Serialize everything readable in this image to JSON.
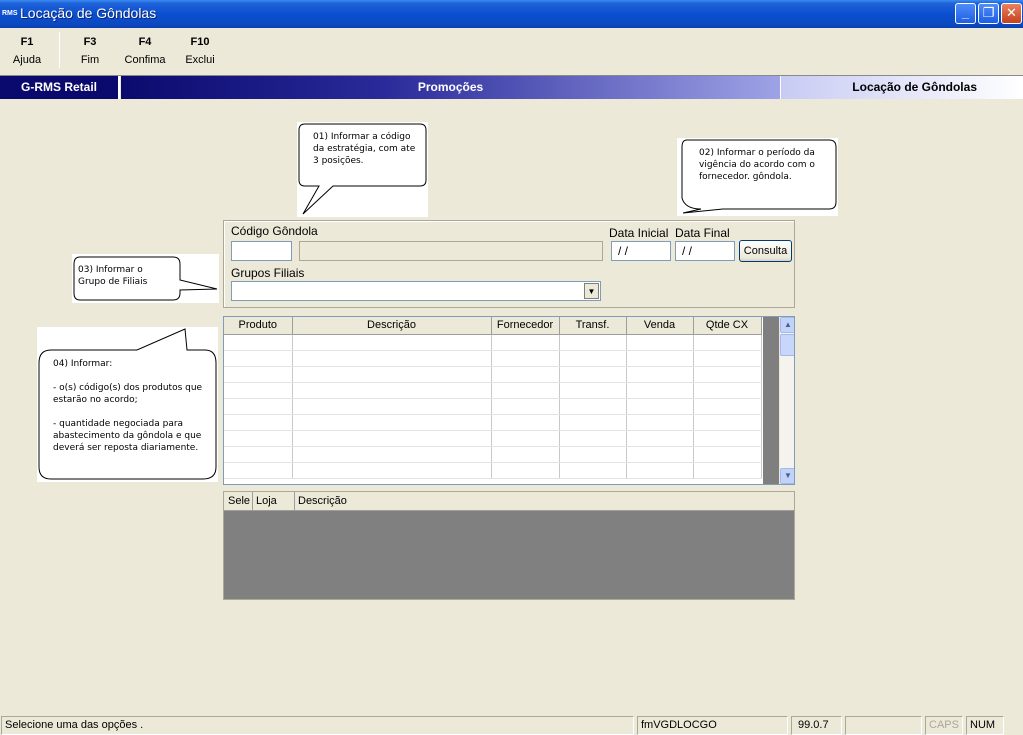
{
  "window": {
    "app_icon": "RMS",
    "title": "Locação de Gôndolas",
    "controls": {
      "minimize": "_",
      "restore": "❐",
      "close": "✕"
    }
  },
  "toolbar": {
    "items": [
      {
        "key": "F1",
        "label": "Ajuda"
      },
      {
        "key": "F3",
        "label": "Fim"
      },
      {
        "key": "F4",
        "label": "Confima"
      },
      {
        "key": "F10",
        "label": "Exclui"
      }
    ]
  },
  "banner": {
    "left": "G-RMS Retail",
    "center": "Promoções",
    "right": "Locação de Gôndolas"
  },
  "callouts": {
    "c1": [
      "01) Informar a código",
      "da estratégia, com ate",
      "3 posições."
    ],
    "c2": [
      "02) Informar o período da",
      "vigência do acordo com o",
      "fornecedor. gôndola."
    ],
    "c3": [
      "03) Informar o",
      "Grupo de Filiais"
    ],
    "c4": [
      "04) Informar:",
      "",
      "- o(s) código(s) dos produtos que",
      "estarão no acordo;",
      "",
      "- quantidade negociada para",
      "abastecimento da gôndola e que",
      "deverá ser reposta diariamente."
    ]
  },
  "form": {
    "codigo_label": "Código Gôndola",
    "codigo_value": "",
    "descricao_value": "",
    "data_inicial_label": "Data Inicial",
    "data_inicial_value": "/ /",
    "data_final_label": "Data Final",
    "data_final_value": "/ /",
    "consulta_label": "Consulta",
    "grupos_label": "Grupos Filiais",
    "grupos_value": ""
  },
  "grid": {
    "columns": [
      "Produto",
      "Descrição",
      "Fornecedor",
      "Transf.",
      "Venda",
      "Qtde CX"
    ],
    "rows": [
      [
        "",
        "",
        "",
        "",
        "",
        ""
      ],
      [
        "",
        "",
        "",
        "",
        "",
        ""
      ],
      [
        "",
        "",
        "",
        "",
        "",
        ""
      ],
      [
        "",
        "",
        "",
        "",
        "",
        ""
      ],
      [
        "",
        "",
        "",
        "",
        "",
        ""
      ],
      [
        "",
        "",
        "",
        "",
        "",
        ""
      ],
      [
        "",
        "",
        "",
        "",
        "",
        ""
      ],
      [
        "",
        "",
        "",
        "",
        "",
        ""
      ],
      [
        "",
        "",
        "",
        "",
        "",
        ""
      ]
    ],
    "scroll_up": "▲",
    "scroll_down": "▼"
  },
  "list2": {
    "columns": [
      "Sele",
      "Loja",
      "Descrição"
    ]
  },
  "statusbar": {
    "message": "Selecione uma das opções .",
    "form_id": "fmVGDLOCGO",
    "version": "99.0.7",
    "blank": "",
    "caps": "CAPS",
    "num": "NUM"
  }
}
